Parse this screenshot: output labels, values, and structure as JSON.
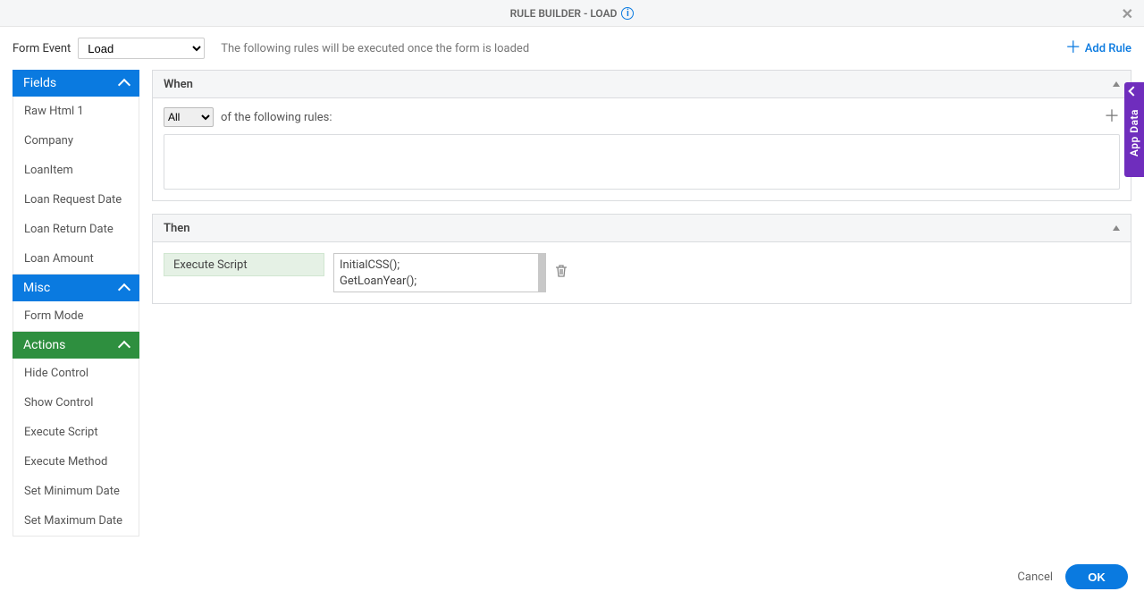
{
  "header": {
    "title": "RULE BUILDER - LOAD"
  },
  "event_row": {
    "label": "Form Event",
    "selected": "Load",
    "description": "The following rules will be executed once the form is loaded",
    "add_rule_label": "Add Rule"
  },
  "sidebar": {
    "fields_header": "Fields",
    "fields": [
      "Raw Html 1",
      "Company",
      "LoanItem",
      "Loan Request Date",
      "Loan Return Date",
      "Loan Amount"
    ],
    "misc_header": "Misc",
    "misc": [
      "Form Mode"
    ],
    "actions_header": "Actions",
    "actions": [
      "Hide Control",
      "Show Control",
      "Execute Script",
      "Execute Method",
      "Set Minimum Date",
      "Set Maximum Date"
    ]
  },
  "rule": {
    "when_label": "When",
    "when_match": "All",
    "when_text": "of the following rules:",
    "then_label": "Then",
    "then_action": "Execute Script",
    "script_line1": "InitialCSS();",
    "script_line2": "GetLoanYear();"
  },
  "appdata": {
    "label": "App Data"
  },
  "footer": {
    "cancel": "Cancel",
    "ok": "OK"
  }
}
